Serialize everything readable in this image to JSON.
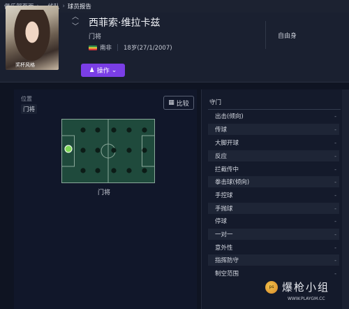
{
  "breadcrumb": [
    "俱乐部页面",
    "一线队",
    "球员报告"
  ],
  "player": {
    "name": "西菲索·维拉卡兹",
    "role": "门将",
    "nation": "南非",
    "age": "18岁(27/1/2007)",
    "status": "自由身",
    "photo_caption": "奖杯风格"
  },
  "operate_label": "操作",
  "position": {
    "section_label": "位置",
    "chip": "门将",
    "caption": "门将"
  },
  "compare_label": "比较",
  "attributes": {
    "header": "守门",
    "items": [
      {
        "label": "出击(倾向)",
        "value": "-"
      },
      {
        "label": "传球",
        "value": "-"
      },
      {
        "label": "大脚开球",
        "value": "-"
      },
      {
        "label": "反应",
        "value": "-"
      },
      {
        "label": "拦截传中",
        "value": "-"
      },
      {
        "label": "拳击球(倾向)",
        "value": "-"
      },
      {
        "label": "手控球",
        "value": "-"
      },
      {
        "label": "手抛球",
        "value": "-"
      },
      {
        "label": "停球",
        "value": "-"
      },
      {
        "label": "一对一",
        "value": "-"
      },
      {
        "label": "意外性",
        "value": "-"
      },
      {
        "label": "指挥防守",
        "value": "-"
      },
      {
        "label": "制空范围",
        "value": "-"
      }
    ]
  },
  "watermark": {
    "text": "爆枪小组",
    "url": "WWW.PLAYGM.CC",
    "badge": "ps"
  },
  "colors": {
    "accent": "#7a3ee6",
    "pitch": "#1f4a3c",
    "active_position": "#7ed957"
  }
}
